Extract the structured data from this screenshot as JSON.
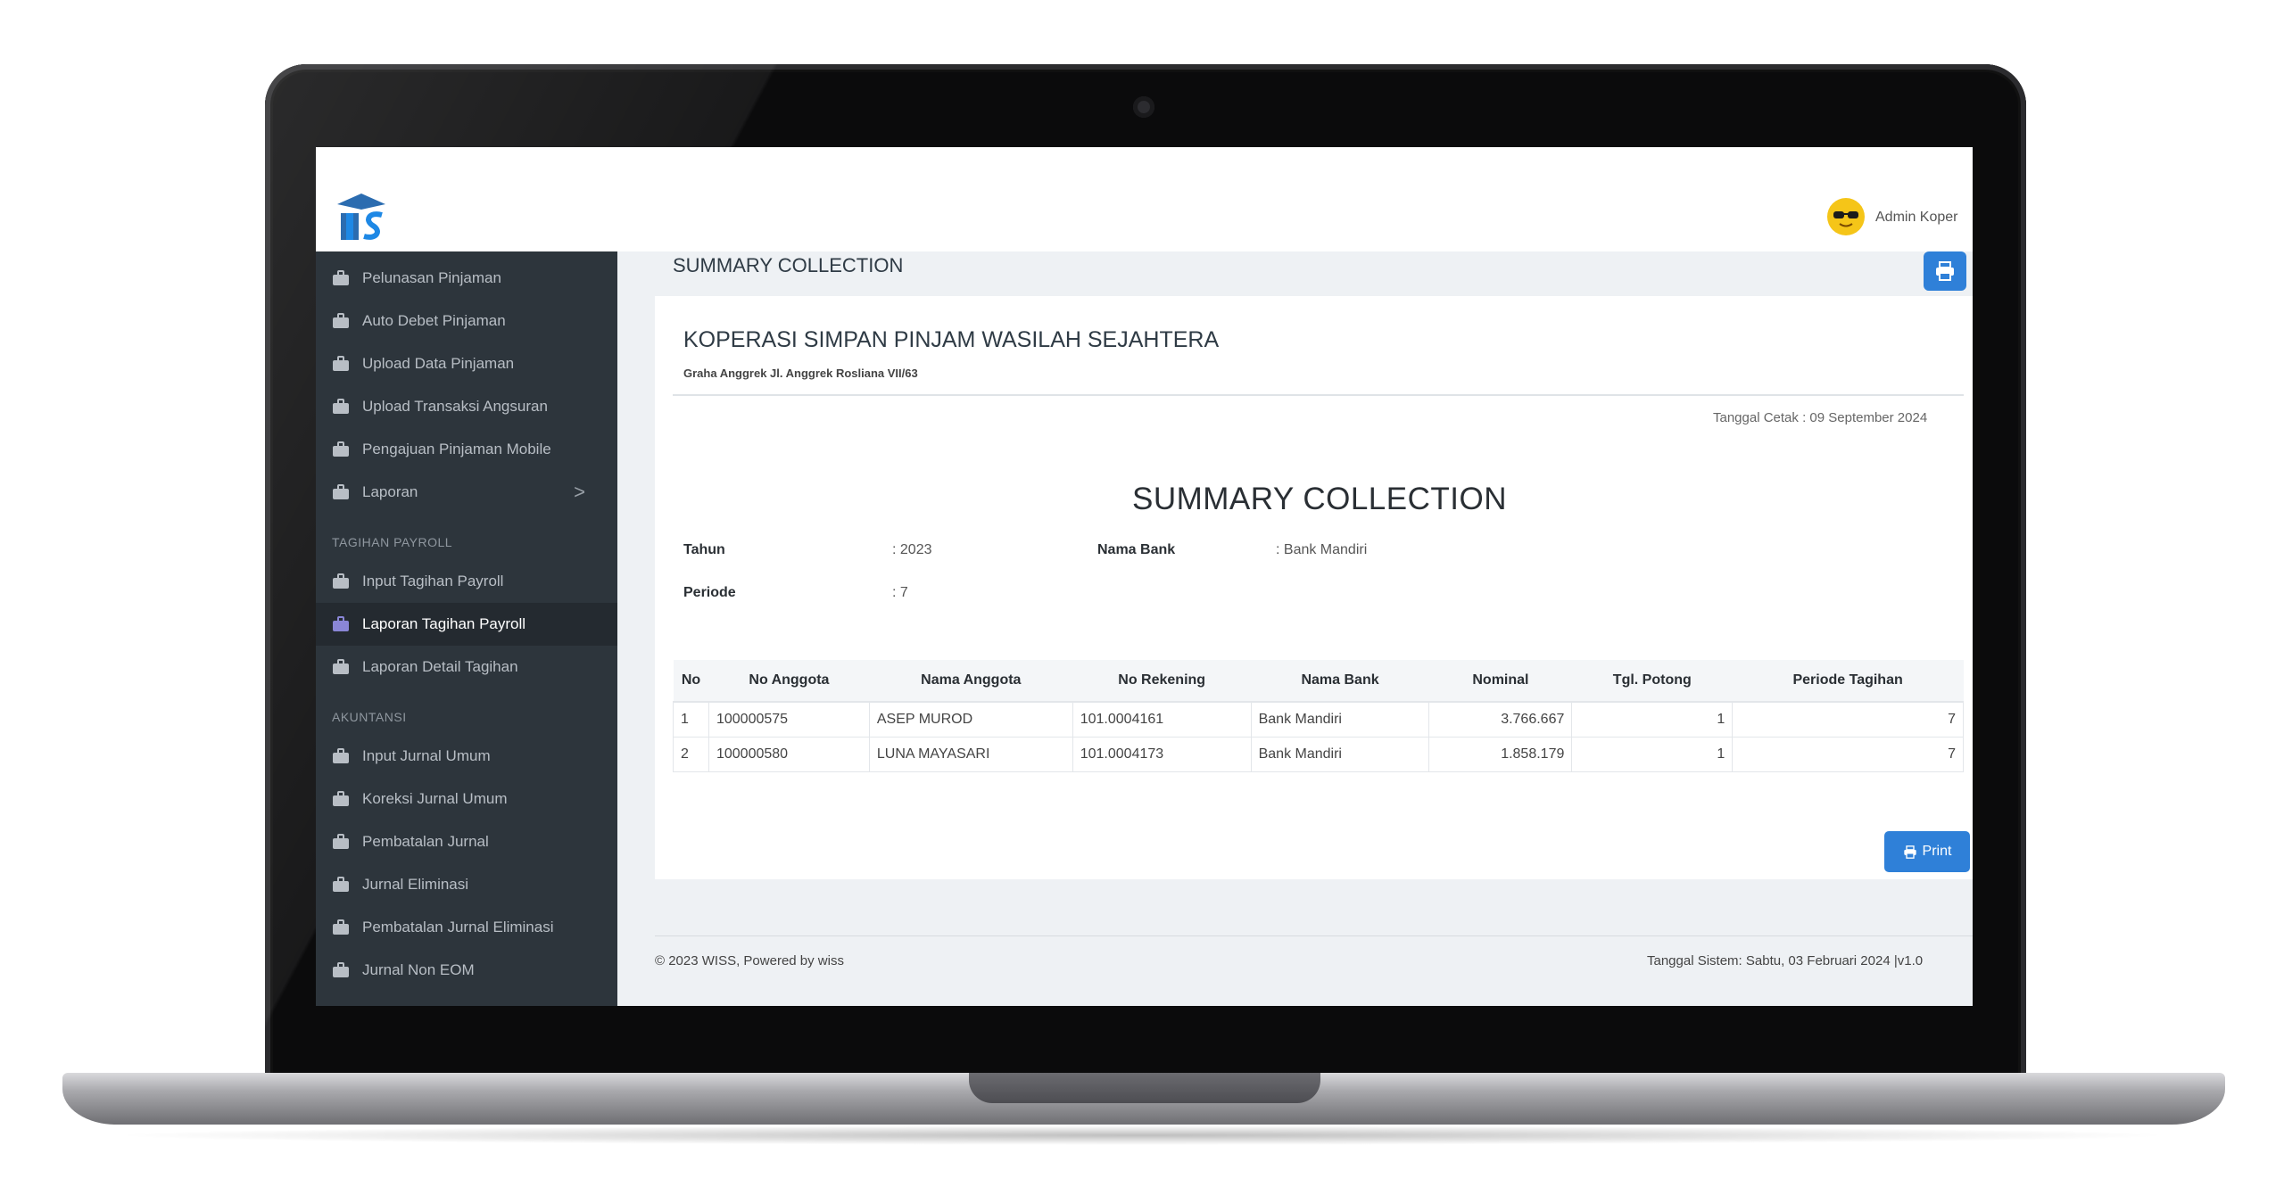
{
  "topbar": {
    "user_name": "Admin Koper"
  },
  "sidebar": {
    "items_top": [
      {
        "label": "Pelunasan Pinjaman"
      },
      {
        "label": "Auto Debet Pinjaman"
      },
      {
        "label": "Upload Data Pinjaman"
      },
      {
        "label": "Upload Transaksi Angsuran"
      },
      {
        "label": "Pengajuan Pinjaman Mobile"
      },
      {
        "label": "Laporan",
        "chevron": ">"
      }
    ],
    "section_payroll": "TAGIHAN PAYROLL",
    "items_payroll": [
      {
        "label": "Input Tagihan Payroll"
      },
      {
        "label": "Laporan Tagihan Payroll",
        "active": true
      },
      {
        "label": "Laporan Detail Tagihan"
      }
    ],
    "section_akuntansi": "AKUNTANSI",
    "items_akuntansi": [
      {
        "label": "Input Jurnal Umum"
      },
      {
        "label": "Koreksi Jurnal Umum"
      },
      {
        "label": "Pembatalan Jurnal"
      },
      {
        "label": "Jurnal Eliminasi"
      },
      {
        "label": "Pembatalan Jurnal Eliminasi"
      },
      {
        "label": "Jurnal Non EOM"
      }
    ]
  },
  "header": {
    "title": "SUMMARY COLLECTION"
  },
  "report": {
    "company_name": "KOPERASI SIMPAN PINJAM WASILAH SEJAHTERA",
    "company_address": "Graha Anggrek Jl. Anggrek Rosliana VII/63",
    "print_date": "Tanggal Cetak : 09 September 2024",
    "title": "SUMMARY COLLECTION",
    "tahun_label": "Tahun",
    "tahun_value": ": 2023",
    "bank_label": "Nama Bank",
    "bank_value": ": Bank Mandiri",
    "periode_label": "Periode",
    "periode_value": ": 7",
    "columns": [
      "No",
      "No Anggota",
      "Nama Anggota",
      "No Rekening",
      "Nama Bank",
      "Nominal",
      "Tgl. Potong",
      "Periode Tagihan"
    ],
    "rows": [
      [
        "1",
        "100000575",
        "ASEP MUROD",
        "101.0004161",
        "Bank Mandiri",
        "3.766.667",
        "1",
        "7"
      ],
      [
        "2",
        "100000580",
        "LUNA MAYASARI",
        "101.0004173",
        "Bank Mandiri",
        "1.858.179",
        "1",
        "7"
      ]
    ],
    "print_button": "Print"
  },
  "footer": {
    "left": "© 2023 WISS, Powered by wiss",
    "right": "Tanggal Sistem: Sabtu, 03 Februari 2024 |v1.0"
  },
  "colors": {
    "accent": "#2f80d8",
    "sidebar": "#2d353c",
    "avatar": "#f5c518"
  },
  "icons": {
    "menu_icon": "briefcase-icon",
    "header_print": "printer-icon",
    "avatar": "sunglasses-face-icon"
  }
}
